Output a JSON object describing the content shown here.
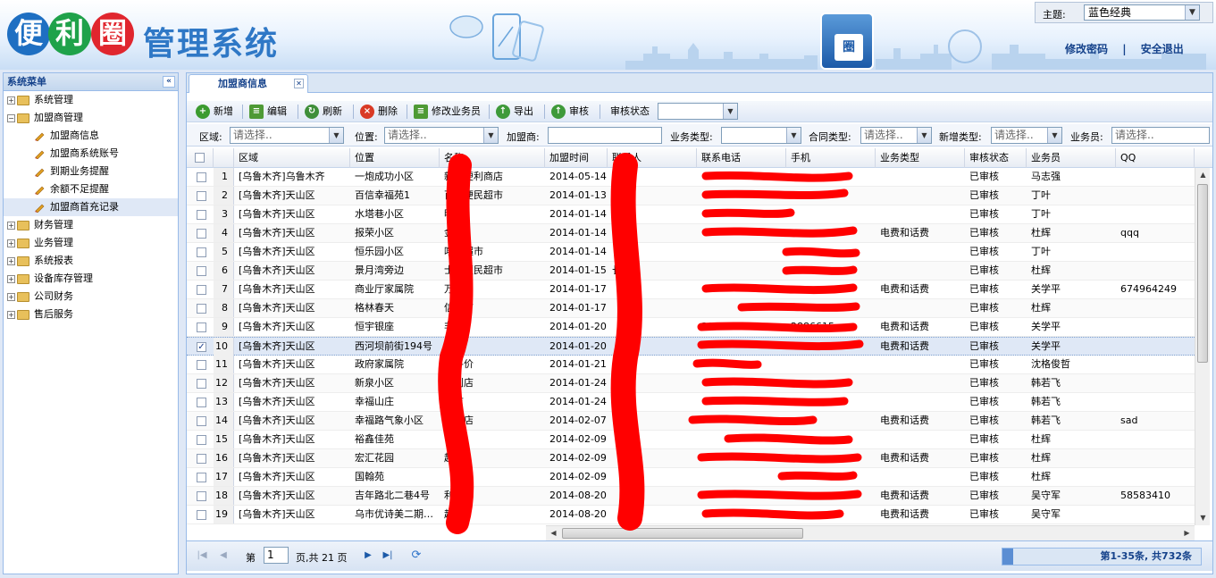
{
  "header": {
    "logo_chars": [
      "便",
      "利",
      "圈"
    ],
    "system_title": "管理系统",
    "badge_char": "圈",
    "theme_label": "主题:",
    "theme_value": "蓝色经典",
    "change_password": "修改密码",
    "divider": "|",
    "logout": "安全退出"
  },
  "sidebar": {
    "title": "系统菜单",
    "items": [
      {
        "label": "系统管理",
        "type": "root",
        "expander": "+"
      },
      {
        "label": "加盟商管理",
        "type": "root-open",
        "expander": "−"
      },
      {
        "label": "加盟商信息",
        "type": "child"
      },
      {
        "label": "加盟商系统账号",
        "type": "child"
      },
      {
        "label": "到期业务提醒",
        "type": "child"
      },
      {
        "label": "余额不足提醒",
        "type": "child"
      },
      {
        "label": "加盟商首充记录",
        "type": "child",
        "selected": true
      },
      {
        "label": "财务管理",
        "type": "root",
        "expander": "+"
      },
      {
        "label": "业务管理",
        "type": "root",
        "expander": "+"
      },
      {
        "label": "系统报表",
        "type": "root",
        "expander": "+"
      },
      {
        "label": "设备库存管理",
        "type": "root",
        "expander": "+"
      },
      {
        "label": "公司财务",
        "type": "root",
        "expander": "+"
      },
      {
        "label": "售后服务",
        "type": "root",
        "expander": "+"
      }
    ]
  },
  "tab": {
    "label": "加盟商信息"
  },
  "toolbar": {
    "add": "新增",
    "edit": "编辑",
    "refresh": "刷新",
    "delete": "删除",
    "change_salesman": "修改业务员",
    "export": "导出",
    "audit": "审核",
    "audit_status_label": "审核状态"
  },
  "filters": {
    "region_label": "区域:",
    "region_ph": "请选择..",
    "location_label": "位置:",
    "location_ph": "请选择..",
    "dealer_label": "加盟商:",
    "biz_type_label": "业务类型:",
    "contract_type_label": "合同类型:",
    "contract_type_ph": "请选择..",
    "new_type_label": "新增类型:",
    "new_type_ph": "请选择..",
    "salesman_label": "业务员:",
    "salesman_ph": "请选择.."
  },
  "columns": [
    "区域",
    "位置",
    "名称",
    "加盟时间",
    "联系人",
    "联系电话",
    "手机",
    "业务类型",
    "审核状态",
    "业务员",
    "QQ"
  ],
  "rows": [
    {
      "n": "1",
      "region": "[乌鲁木齐]乌鲁木齐",
      "loc": "一炮成功小区",
      "name": "新疆便利商店",
      "date": "2014-05-14",
      "contact": "",
      "phone": "",
      "mobile": "",
      "biz": "",
      "status": "已审核",
      "sales": "马志强",
      "qq": ""
    },
    {
      "n": "2",
      "region": "[乌鲁木齐]天山区",
      "loc": "百信幸福苑1",
      "name": "百信便民超市",
      "date": "2014-01-13",
      "contact": "",
      "phone": "",
      "mobile": "",
      "biz": "",
      "status": "已审核",
      "sales": "丁叶",
      "qq": ""
    },
    {
      "n": "3",
      "region": "[乌鲁木齐]天山区",
      "loc": "水塔巷小区",
      "name": "明",
      "date": "2014-01-14",
      "contact": "",
      "phone": "",
      "mobile": "",
      "biz": "",
      "status": "已审核",
      "sales": "丁叶",
      "qq": ""
    },
    {
      "n": "4",
      "region": "[乌鲁木齐]天山区",
      "loc": "报荣小区",
      "name": "金",
      "date": "2014-01-14",
      "contact": "",
      "phone": "",
      "mobile": "",
      "biz": "电费和话费",
      "status": "已审核",
      "sales": "杜辉",
      "qq": "qqq"
    },
    {
      "n": "5",
      "region": "[乌鲁木齐]天山区",
      "loc": "恒乐园小区",
      "name": "喀什超市",
      "date": "2014-01-14",
      "contact": "",
      "phone": "",
      "mobile": "",
      "biz": "",
      "status": "已审核",
      "sales": "丁叶",
      "qq": ""
    },
    {
      "n": "6",
      "region": "[乌鲁木齐]天山区",
      "loc": "景月湾旁边",
      "name": "士多便民超市",
      "date": "2014-01-15",
      "contact": "长提",
      "phone": "",
      "mobile": "",
      "biz": "",
      "status": "已审核",
      "sales": "杜辉",
      "qq": ""
    },
    {
      "n": "7",
      "region": "[乌鲁木齐]天山区",
      "loc": "商业厅家属院",
      "name": "万",
      "date": "2014-01-17",
      "contact": "",
      "phone": "",
      "mobile": "",
      "biz": "电费和话费",
      "status": "已审核",
      "sales": "关学平",
      "qq": "674964249"
    },
    {
      "n": "8",
      "region": "[乌鲁木齐]天山区",
      "loc": "格林春天",
      "name": "信超市",
      "date": "2014-01-17",
      "contact": "",
      "phone": "",
      "mobile": "",
      "biz": "",
      "status": "已审核",
      "sales": "杜辉",
      "qq": ""
    },
    {
      "n": "9",
      "region": "[乌鲁木齐]天山区",
      "loc": "恒宇银座",
      "name": "非利",
      "date": "2014-01-20",
      "contact": "",
      "phone": "2886615",
      "mobile": "2886615",
      "biz": "电费和话费",
      "status": "已审核",
      "sales": "关学平",
      "qq": ""
    },
    {
      "n": "10",
      "region": "[乌鲁木齐]天山区",
      "loc": "西河坝前街194号",
      "name": "小物",
      "date": "2014-01-20",
      "contact": "",
      "phone": "",
      "mobile": "",
      "biz": "电费和话费",
      "status": "已审核",
      "sales": "关学平",
      "qq": ""
    },
    {
      "n": "11",
      "region": "[乌鲁木齐]天山区",
      "loc": "政府家属院",
      "name": "金平价",
      "date": "2014-01-21",
      "contact": "",
      "phone": "",
      "mobile": "",
      "biz": "",
      "status": "已审核",
      "sales": "沈格俊哲",
      "qq": ""
    },
    {
      "n": "12",
      "region": "[乌鲁木齐]天山区",
      "loc": "新泉小区",
      "name": "便利店",
      "date": "2014-01-24",
      "contact": "",
      "phone": "",
      "mobile": "",
      "biz": "",
      "status": "已审核",
      "sales": "韩若飞",
      "qq": ""
    },
    {
      "n": "13",
      "region": "[乌鲁木齐]天山区",
      "loc": "幸福山庄",
      "name": "超市",
      "date": "2014-01-24",
      "contact": "",
      "phone": "",
      "mobile": "",
      "biz": "",
      "status": "已审核",
      "sales": "韩若飞",
      "qq": ""
    },
    {
      "n": "14",
      "region": "[乌鲁木齐]天山区",
      "loc": "幸福路气象小区",
      "name": "便利店",
      "date": "2014-02-07",
      "contact": "",
      "phone": "",
      "mobile": "",
      "biz": "电费和话费",
      "status": "已审核",
      "sales": "韩若飞",
      "qq": "sad"
    },
    {
      "n": "15",
      "region": "[乌鲁木齐]天山区",
      "loc": "裕鑫佳苑",
      "name": "",
      "date": "2014-02-09",
      "contact": "",
      "phone": "",
      "mobile": "",
      "biz": "",
      "status": "已审核",
      "sales": "杜辉",
      "qq": ""
    },
    {
      "n": "16",
      "region": "[乌鲁木齐]天山区",
      "loc": "宏汇花园",
      "name": "超市",
      "date": "2014-02-09",
      "contact": "",
      "phone": "",
      "mobile": "",
      "biz": "电费和话费",
      "status": "已审核",
      "sales": "杜辉",
      "qq": ""
    },
    {
      "n": "17",
      "region": "[乌鲁木齐]天山区",
      "loc": "国翰苑",
      "name": "",
      "date": "2014-02-09",
      "contact": "",
      "phone": "",
      "mobile": "",
      "biz": "",
      "status": "已审核",
      "sales": "杜辉",
      "qq": ""
    },
    {
      "n": "18",
      "region": "[乌鲁木齐]天山区",
      "loc": "吉年路北二巷4号",
      "name": "利店",
      "date": "2014-08-20",
      "contact": "",
      "phone": "",
      "mobile": "",
      "biz": "电费和话费",
      "status": "已审核",
      "sales": "吴守军",
      "qq": "58583410"
    },
    {
      "n": "19",
      "region": "[乌鲁木齐]天山区",
      "loc": "乌市优诗美二期…",
      "name": "超市",
      "date": "2014-08-20",
      "contact": "",
      "phone": "",
      "mobile": "",
      "biz": "电费和话费",
      "status": "已审核",
      "sales": "吴守军",
      "qq": ""
    }
  ],
  "pager": {
    "page_prefix": "第",
    "page_value": "1",
    "page_suffix": "页,共 21 页",
    "summary": "第1-35条, 共732条"
  },
  "colors": {
    "accent": "#15428b",
    "panel_border": "#99bbe8",
    "redaction": "#ff0000"
  }
}
